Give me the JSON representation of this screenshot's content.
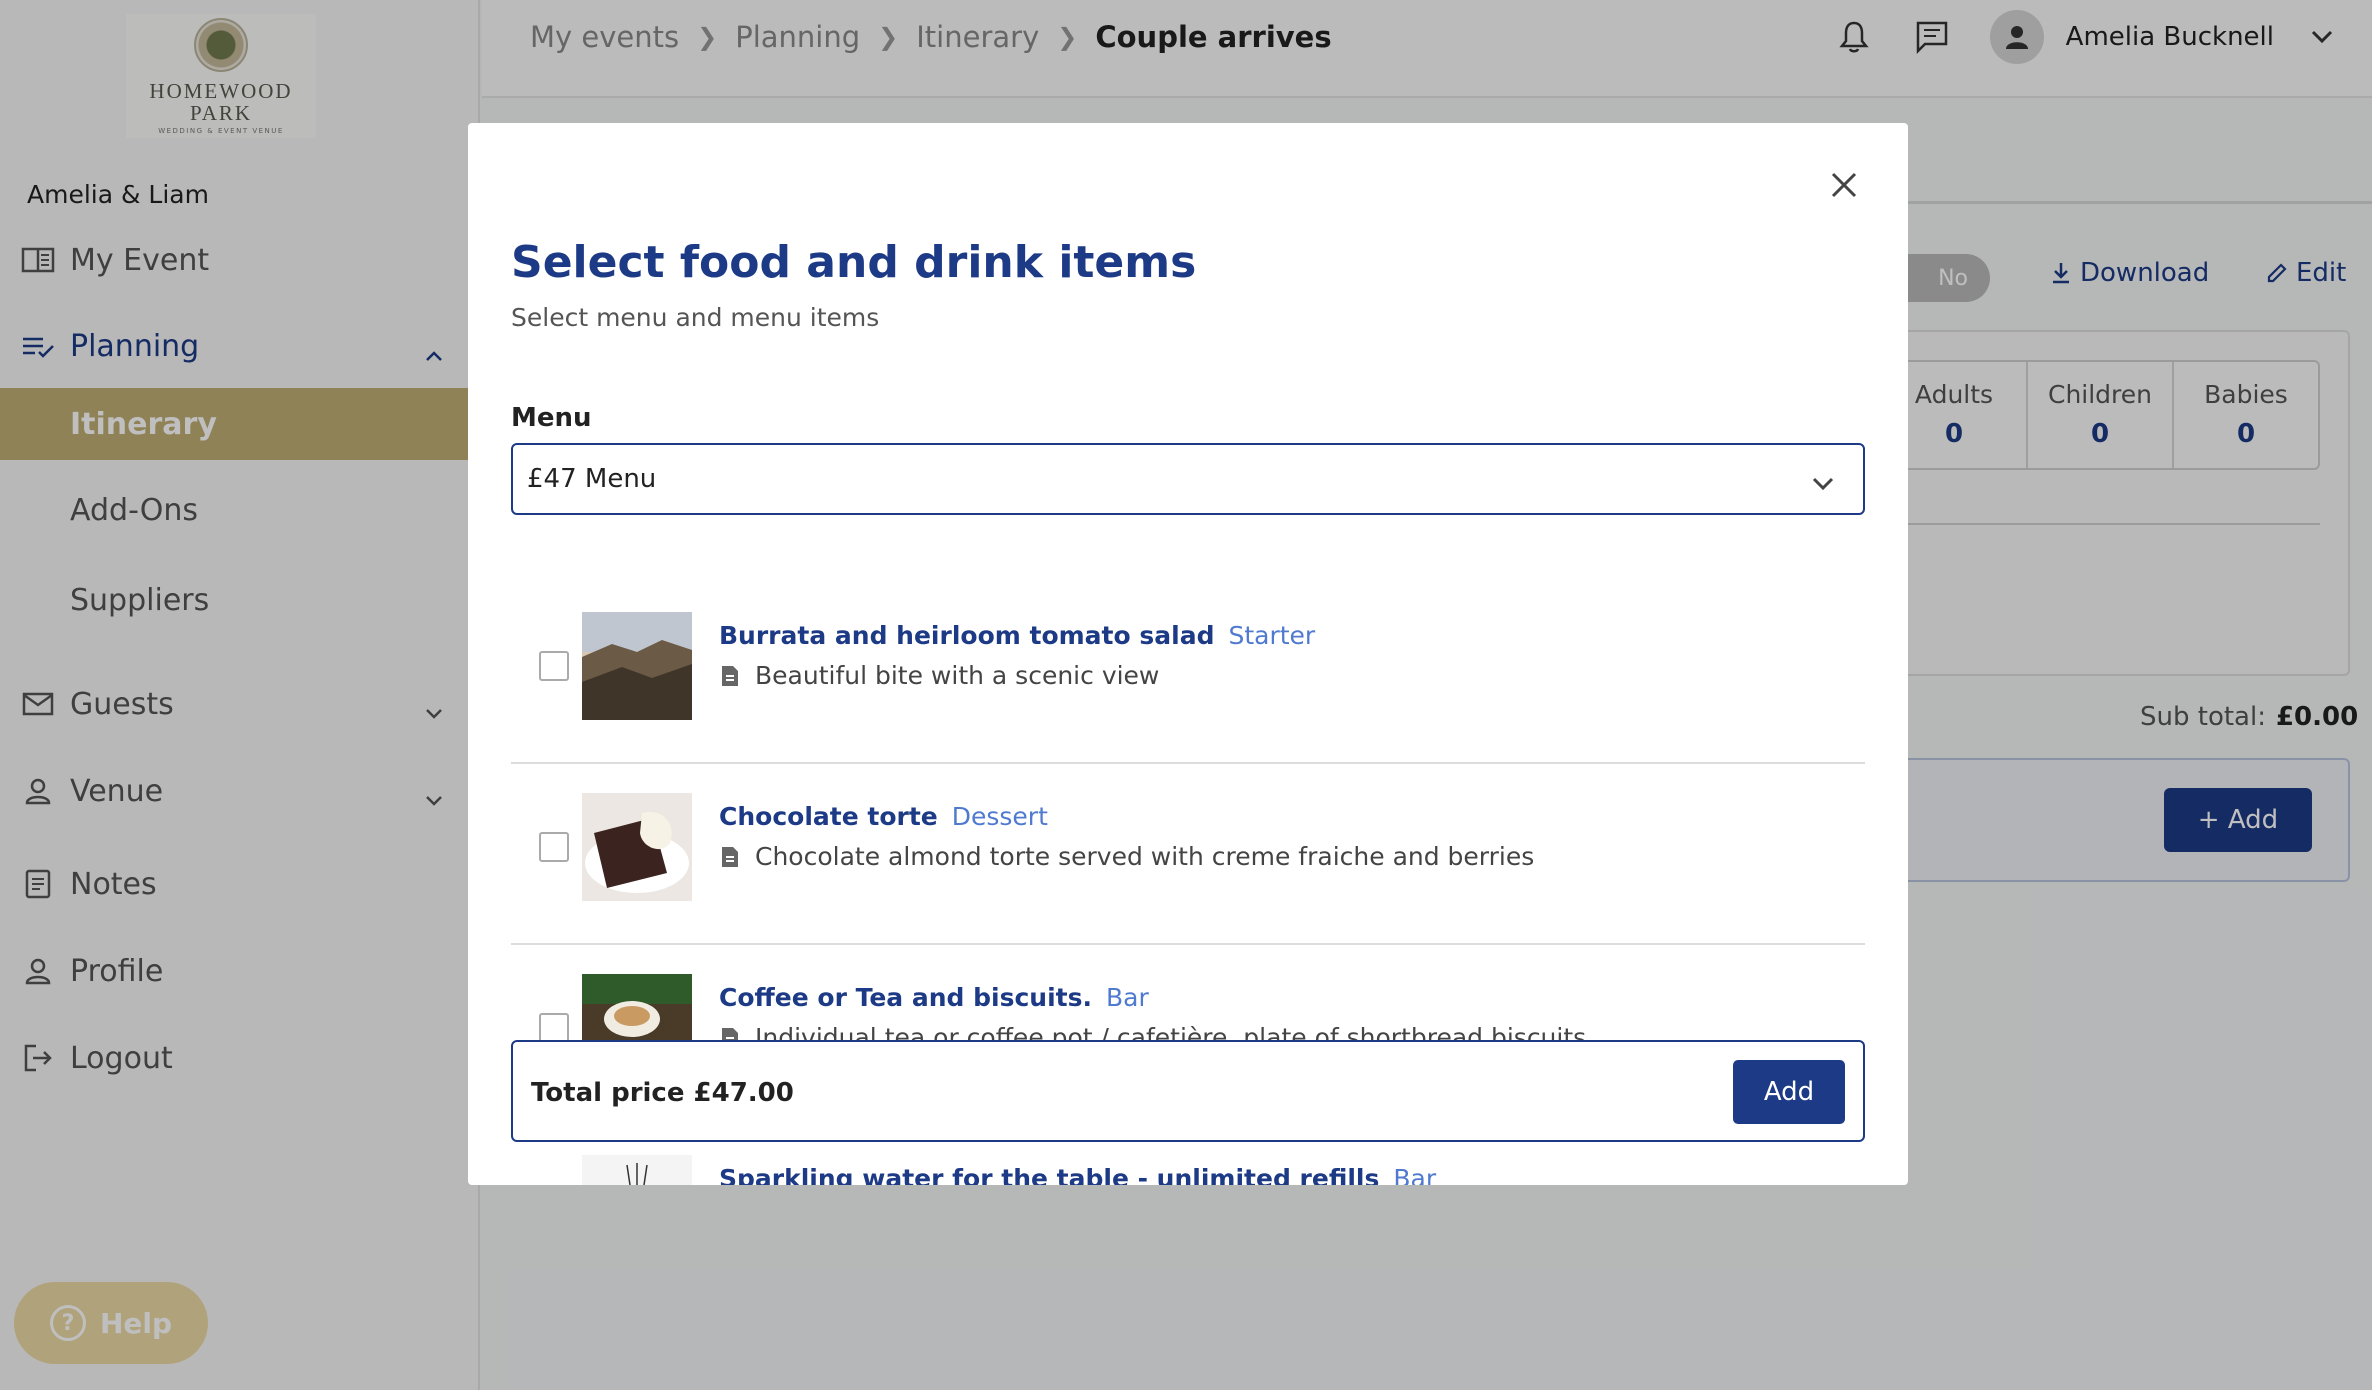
{
  "venue": {
    "logo_line1": "HOMEWOOD",
    "logo_line2": "PARK",
    "logo_line3": "WEDDING & EVENT VENUE"
  },
  "sidebar": {
    "event_name": "Amelia & Liam",
    "items": [
      {
        "label": "My Event",
        "icon": "book-icon"
      },
      {
        "label": "Planning",
        "icon": "checklist-icon",
        "expanded": true
      },
      {
        "label": "Itinerary",
        "active": true
      },
      {
        "label": "Add-Ons"
      },
      {
        "label": "Suppliers"
      },
      {
        "label": "Guests",
        "icon": "mail-icon"
      },
      {
        "label": "Venue",
        "icon": "person-icon"
      },
      {
        "label": "Notes",
        "icon": "notes-icon"
      },
      {
        "label": "Profile",
        "icon": "person-icon"
      },
      {
        "label": "Logout",
        "icon": "logout-icon"
      }
    ],
    "help_label": "Help"
  },
  "breadcrumb": [
    "My events",
    "Planning",
    "Itinerary",
    "Couple arrives"
  ],
  "user": {
    "name": "Amelia Bucknell"
  },
  "background": {
    "toggle_label": "No",
    "download_label": "Download",
    "edit_label": "Edit",
    "counts": [
      {
        "label": "Adults",
        "value": "0"
      },
      {
        "label": "Children",
        "value": "0"
      },
      {
        "label": "Babies",
        "value": "0"
      }
    ],
    "subtotal_label": "Sub total:",
    "subtotal_value": "£0.00",
    "add_label": "+ Add"
  },
  "modal": {
    "title": "Select food and drink items",
    "subtitle": "Select menu and menu items",
    "menu_label": "Menu",
    "menu_value": "£47 Menu",
    "items": [
      {
        "name": "Burrata and heirloom tomato salad",
        "category": "Starter",
        "description": "Beautiful bite with a scenic view",
        "checked": false
      },
      {
        "name": "Chocolate torte",
        "category": "Dessert",
        "description": "Chocolate almond torte served with creme fraiche and berries",
        "checked": false
      },
      {
        "name": "Coffee or Tea and biscuits.",
        "category": "Bar",
        "description": "Individual tea or coffee pot / cafetière, plate of shortbread biscuits",
        "checked": false
      },
      {
        "name": "Sparkling water for the table - unlimited refills",
        "category": "Bar",
        "description": "",
        "checked": false
      }
    ],
    "total_label": "Total price £47.00",
    "add_label": "Add"
  },
  "colors": {
    "brand_blue": "#1d3a86",
    "accent_gold": "#bfae73",
    "category_blue": "#4f7ad0"
  }
}
